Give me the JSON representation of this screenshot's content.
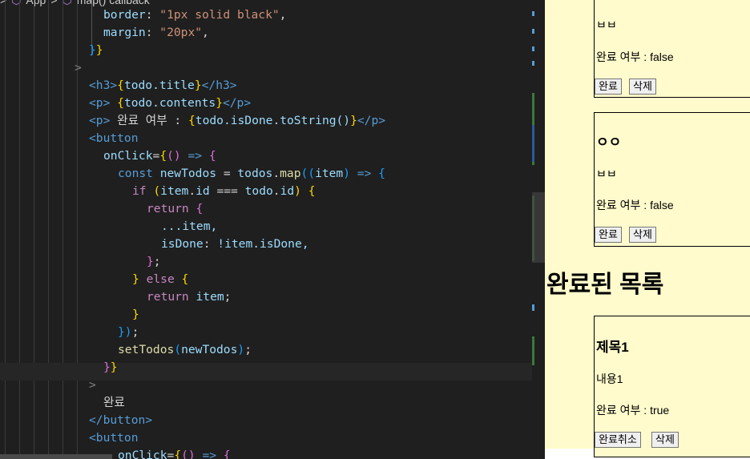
{
  "editor": {
    "breadcrumb": {
      "sep1": ">",
      "app": "App",
      "sep2": ">",
      "callback": "map() callback"
    },
    "lines": {
      "l1_prop": "border",
      "l1_val": "\"1px solid black\"",
      "l2_prop": "margin",
      "l2_val": "\"20px\"",
      "h3_tag_open": "<h3>",
      "h3_expr": "todo.title",
      "h3_tag_close": "</h3>",
      "p1_tag_open": "<p>",
      "p1_expr": "todo.contents",
      "p1_tag_close": "</p>",
      "p2_tag_open": "<p>",
      "p2_text": " 완료 여부 : ",
      "p2_expr": "todo.isDone.toString()",
      "p2_tag_close": "</p>",
      "button_open": "<button",
      "onclick": "onClick",
      "const_kw": "const",
      "new_todos": "newTodos",
      "todos_map": "todos",
      "map_fn": "map",
      "item_param": "item",
      "if_kw": "if",
      "if_cond_item": "item",
      "if_cond_id": "id",
      "if_cond_todo": "todo",
      "if_cond_todoid": "id",
      "return_kw": "return",
      "spread": "...item,",
      "is_done_key": "isDone",
      "is_done_val": "!item.isDone,",
      "else_kw": "else",
      "return_item": "item",
      "set_todos": "setTodos",
      "set_todos_arg": "newTodos",
      "btn_text": "완료",
      "button_close": "</button>",
      "button_open2": "<button",
      "onclick2": "onClick"
    }
  },
  "preview": {
    "card1": {
      "contents": "ㅂㅂ",
      "status_label": "완료 여부 : false",
      "done_button": "완료",
      "delete_button": "삭제"
    },
    "card2": {
      "title": "ㅇㅇ",
      "contents": "ㅂㅂ",
      "status_label": "완료 여부 : false",
      "done_button": "완료",
      "delete_button": "삭제"
    },
    "done_section_title": "완료된 목록",
    "card3": {
      "title": "제목1",
      "contents": "내용1",
      "status_label": "완료 여부 : true",
      "undo_button": "완료취소",
      "delete_button": "삭제"
    }
  },
  "colors": {
    "editor_bg": "#1f1f1f",
    "preview_bg": "#fffbcc"
  },
  "icons": [
    "chevron-right-icon",
    "react-component-icon"
  ]
}
